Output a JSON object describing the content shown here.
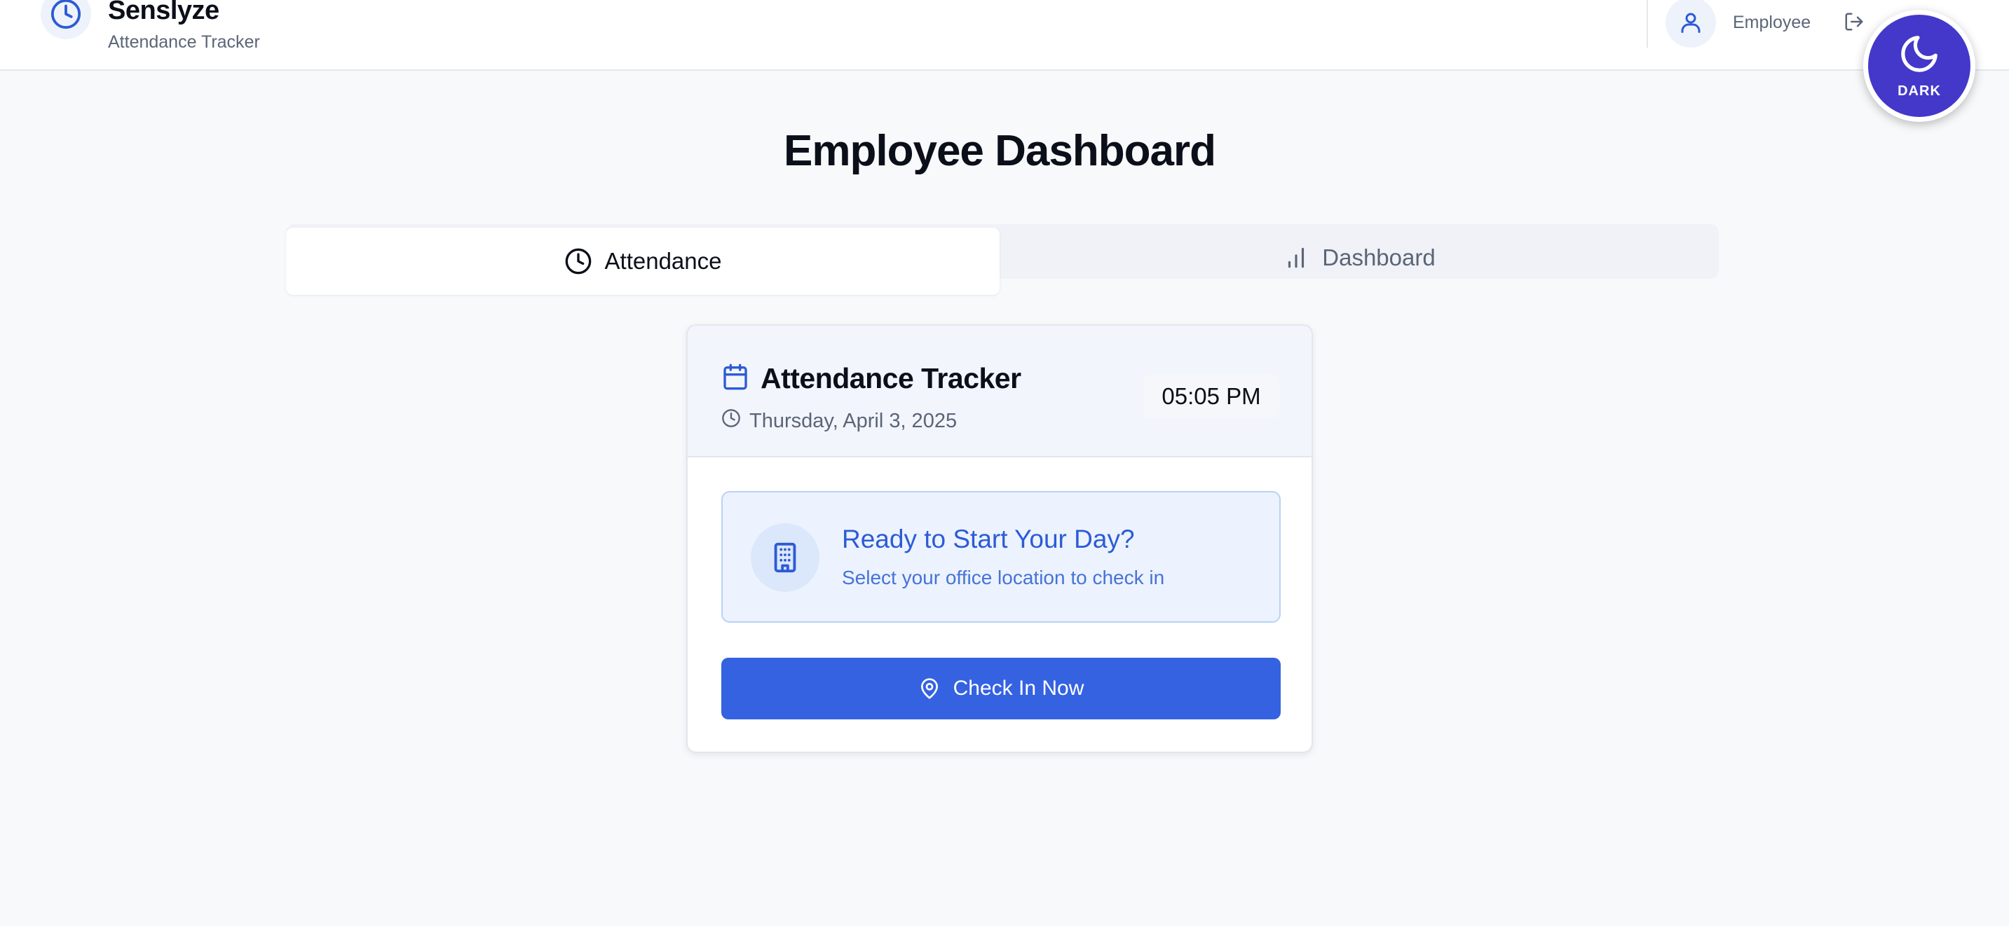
{
  "header": {
    "brand_name": "Senslyze",
    "brand_subtitle": "Attendance Tracker",
    "logo_icon": "clock-icon",
    "user_role": "Employee",
    "user_icon": "user-icon",
    "logout_icon": "logout-icon",
    "theme_toggle_label": "DARK",
    "theme_toggle_icon": "moon-icon"
  },
  "page": {
    "title": "Employee Dashboard"
  },
  "tabs": [
    {
      "label": "Attendance",
      "icon": "clock-icon",
      "active": true
    },
    {
      "label": "Dashboard",
      "icon": "bar-chart-icon",
      "active": false
    }
  ],
  "card": {
    "title": "Attendance Tracker",
    "title_icon": "calendar-icon",
    "date": "Thursday, April 3, 2025",
    "time": "05:05 PM",
    "ready_title": "Ready to Start Your Day?",
    "ready_subtitle": "Select your office location to check in",
    "ready_icon": "building-icon",
    "checkin_label": "Check In Now",
    "checkin_icon": "map-pin-icon"
  },
  "colors": {
    "primary": "#3462e1",
    "theme_toggle": "#4338ca",
    "background": "#f8f9fb",
    "ready_bg": "#ecf3fe"
  }
}
